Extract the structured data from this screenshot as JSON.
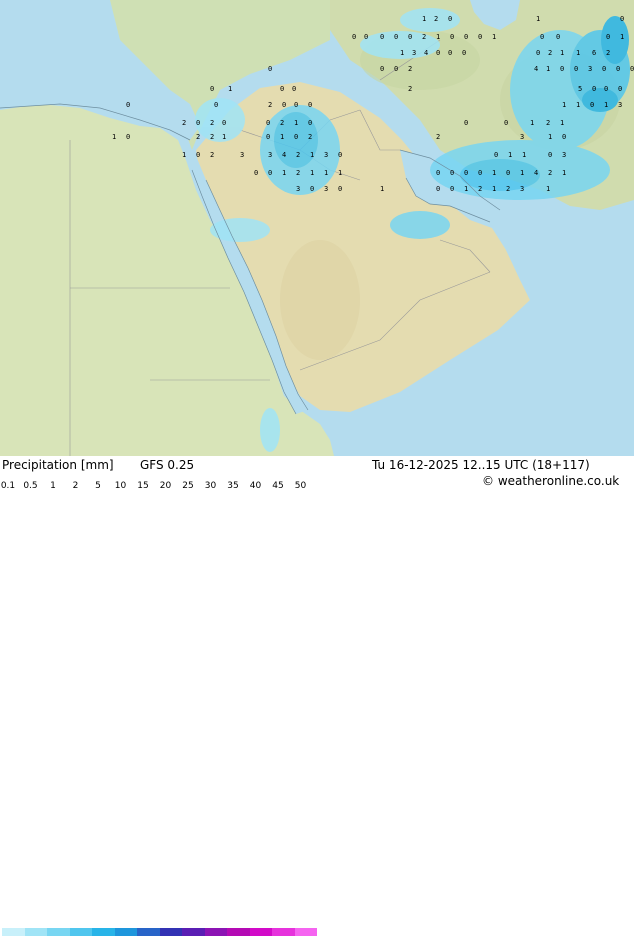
{
  "footer": {
    "product": "Precipitation [mm]",
    "model": "GFS 0.25",
    "datetime": "Tu 16-12-2025 12..15 UTC (18+117)",
    "credit": "© weatheronline.co.uk"
  },
  "legend": {
    "levels": [
      "0.1",
      "0.5",
      "1",
      "2",
      "5",
      "10",
      "15",
      "20",
      "25",
      "30",
      "35",
      "40",
      "45",
      "50"
    ],
    "colors": [
      "#c8f0fa",
      "#a0e4f6",
      "#78d6f2",
      "#50c6ee",
      "#28b4e8",
      "#1e96dc",
      "#2864c8",
      "#3232b4",
      "#5a1eb4",
      "#8c14b4",
      "#b40ab4",
      "#d20ac8",
      "#e632dc",
      "#f564f0"
    ]
  },
  "map": {
    "land_color": "#cfe2b0",
    "sea_color": "#b4dcee",
    "desert_color": "#e8dcb4",
    "precip_values": [
      "1",
      "2",
      "0",
      "1",
      "0",
      "0",
      "0",
      "0",
      "0",
      "0",
      "2",
      "1",
      "0",
      "0",
      "0",
      "1",
      "0",
      "0",
      "0",
      "1",
      "1",
      "3",
      "4",
      "0",
      "0",
      "0",
      "0",
      "2",
      "1",
      "1",
      "6",
      "2",
      "0",
      "0",
      "0",
      "2",
      "4",
      "1",
      "0",
      "0",
      "3",
      "0",
      "0",
      "0",
      "0",
      "1",
      "0",
      "0",
      "2",
      "5",
      "0",
      "0",
      "0",
      "0",
      "0",
      "2",
      "0",
      "0",
      "0",
      "1",
      "1",
      "0",
      "1",
      "3",
      "2",
      "0",
      "2",
      "0",
      "0",
      "2",
      "1",
      "0",
      "0",
      "0",
      "1",
      "2",
      "1",
      "1",
      "0",
      "2",
      "2",
      "1",
      "0",
      "1",
      "0",
      "2",
      "2",
      "3",
      "1",
      "0",
      "1",
      "0",
      "2",
      "3",
      "3",
      "4",
      "2",
      "1",
      "3",
      "0",
      "0",
      "1",
      "1",
      "0",
      "3",
      "0",
      "0",
      "1",
      "2",
      "1",
      "1",
      "1",
      "0",
      "0",
      "0",
      "0",
      "1",
      "0",
      "1",
      "4",
      "2",
      "1",
      "3",
      "0",
      "3",
      "0",
      "1",
      "0",
      "0",
      "1",
      "2",
      "1",
      "2",
      "3",
      "1",
      "0",
      "1",
      "0",
      "1",
      "0",
      "1",
      "3",
      "3",
      "2",
      "0",
      "0",
      "0",
      "1",
      "0",
      "1",
      "0",
      "0",
      "1",
      "0",
      "0",
      "0"
    ]
  }
}
